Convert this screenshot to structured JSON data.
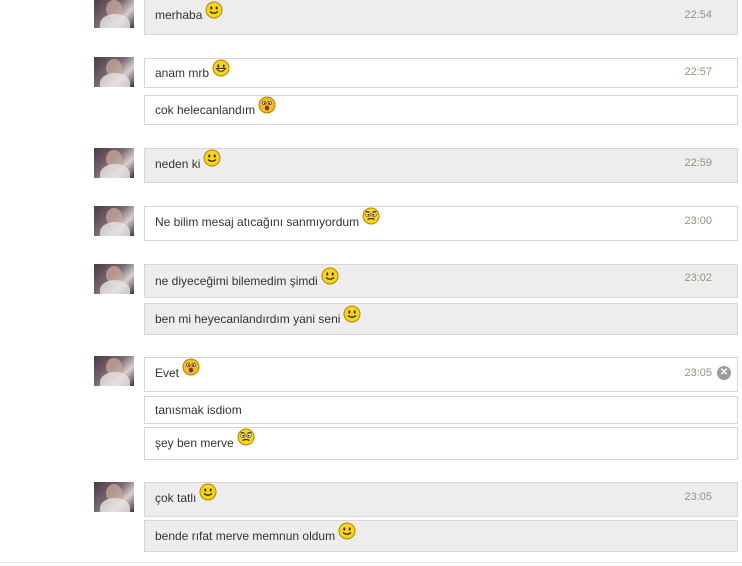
{
  "messages": [
    {
      "time": "22:54",
      "lines": [
        {
          "text": "merhaba",
          "emoji": "smile-icon"
        }
      ]
    },
    {
      "time": "22:57",
      "lines": [
        {
          "text": "anam mrb",
          "emoji": "grin-icon"
        },
        {
          "text": "cok helecanlandım",
          "emoji": "confused-icon"
        }
      ]
    },
    {
      "time": "22:59",
      "lines": [
        {
          "text": "neden ki",
          "emoji": "smile-icon"
        }
      ]
    },
    {
      "time": "23:00",
      "lines": [
        {
          "text": "Ne bilim mesaj atıcağını sanmıyordum",
          "emoji": "worried-icon"
        }
      ]
    },
    {
      "time": "23:02",
      "lines": [
        {
          "text": "ne diyeceğimi bilemedim şimdi",
          "emoji": "smile-icon"
        },
        {
          "text": "ben mi heyecanlandırdım yani seni",
          "emoji": "smile-icon"
        }
      ]
    },
    {
      "time": "23:05",
      "close_icon": "close-icon",
      "lines": [
        {
          "text": "Evet",
          "emoji": "confused-icon"
        },
        {
          "text": "tanısmak isdiom",
          "emoji": null
        },
        {
          "text": "şey ben merve",
          "emoji": "worried-icon"
        }
      ]
    },
    {
      "time": "23:05",
      "lines": [
        {
          "text": "çok tatlı",
          "emoji": "smile-icon"
        },
        {
          "text": "bende rıfat merve memnun oldum",
          "emoji": "smile-icon"
        }
      ]
    }
  ]
}
